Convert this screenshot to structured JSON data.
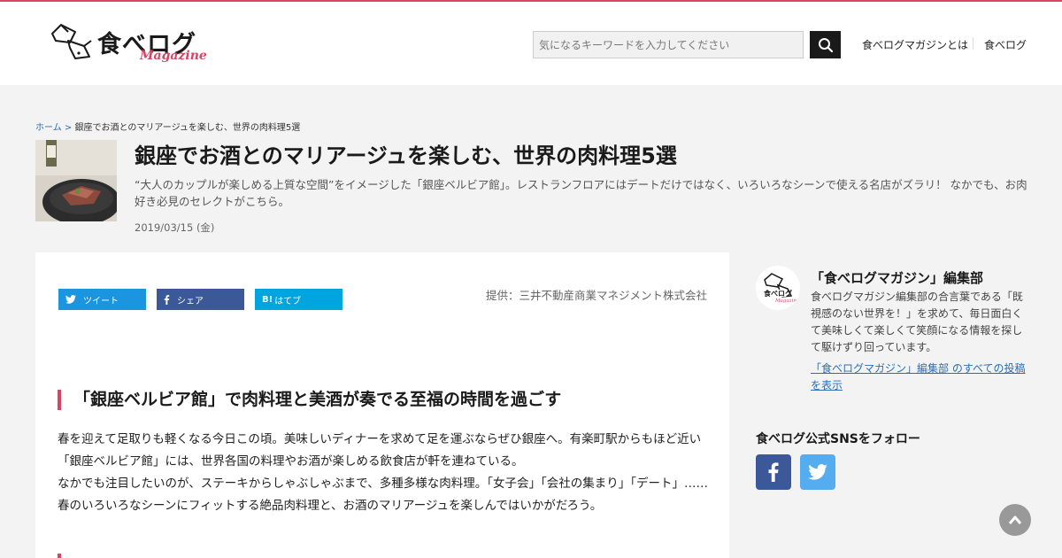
{
  "header": {
    "logo_text": "食べログ",
    "logo_sub": "Magazine",
    "search_placeholder": "気になるキーワードを入力してください",
    "nav": [
      "食べログマガジンとは",
      "食べログ"
    ]
  },
  "breadcrumb": {
    "home": "ホーム",
    "separator": ">",
    "current": "銀座でお酒とのマリアージュを楽しむ、世界の肉料理5選"
  },
  "article": {
    "title": "銀座でお酒とのマリアージュを楽しむ、世界の肉料理5選",
    "lead": "“大人のカップルが楽しめる上質な空間”をイメージした「銀座ベルビア館」。レストランフロアにはデートだけではなく、いろいろなシーンで使える名店がズラリ！ なかでも、お肉好き必見のセレクトがこちら。",
    "date": "2019/03/15 (金)",
    "share": {
      "tweet": "ツイート",
      "share": "シェア",
      "hatena_mark": "B!",
      "hatena": "はてブ"
    },
    "credit": "提供：三井不動産商業マネジメント株式会社",
    "section_heading": "「銀座ベルビア館」で肉料理と美酒が奏でる至福の時間を過ごす",
    "paragraph1": "春を迎えて足取りも軽くなる今日この頃。美味しいディナーを求めて足を運ぶならぜひ銀座へ。有楽町駅からもほど近い「銀座ベルビア館」には、世界各国の料理やお酒が楽しめる飲食店が軒を連ねている。",
    "paragraph2": "なかでも注目したいのが、ステーキからしゃぶしゃぶまで、多種多様な肉料理。「女子会」「会社の集まり」「デート」……春のいろいろなシーンにフィットする絶品肉料理と、お酒のマリアージュを楽しんではいかがだろう。"
  },
  "sidebar": {
    "author_name": "「食べログマガジン」編集部",
    "author_bio": "食べログマガジン編集部の合言葉である「既視感のない世界を！」を求めて、毎日面白くて美味しくて楽しくて笑顔になる情報を探して駆けずり回っています。",
    "author_link": "「食べログマガジン」編集部 のすべての投稿を表示",
    "sns_heading": "食べログ公式SNSをフォロー"
  },
  "colors": {
    "accent": "#d94364",
    "twitter": "#1b95e0",
    "facebook": "#3b5998",
    "hatena": "#00a4de",
    "link": "#2a6fb6"
  }
}
